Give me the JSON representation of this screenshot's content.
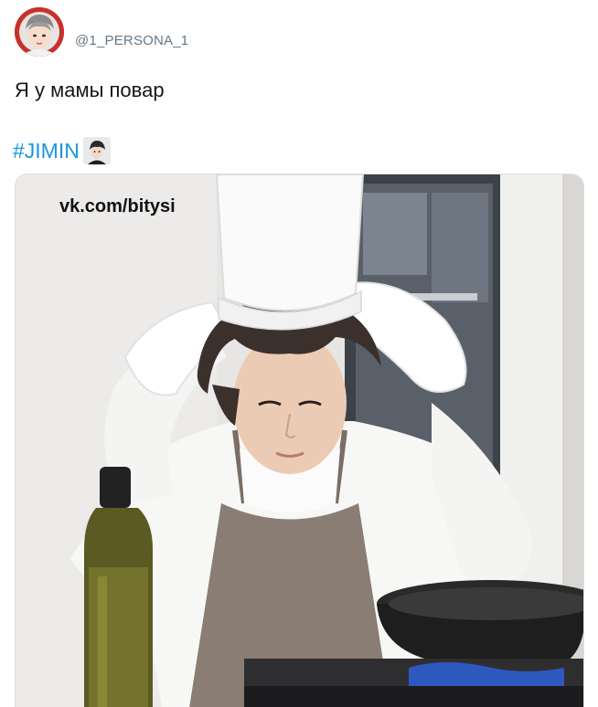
{
  "tweet": {
    "avatar_icon": "cartoon-portrait-avatar",
    "handle": "@1_PERSONA_1",
    "text": "Я у мамы повар",
    "hashtag": "#JIMIN",
    "hashflag_icon": "jimin-hashflag-emoji"
  },
  "media": {
    "description_icon": "photo-chef-in-kitchen",
    "watermark": "vk.com/bitysi"
  },
  "colors": {
    "handle": "#657786",
    "text": "#14171a",
    "hashtag": "#1b95e0",
    "avatar_bg": "#c8312b"
  }
}
